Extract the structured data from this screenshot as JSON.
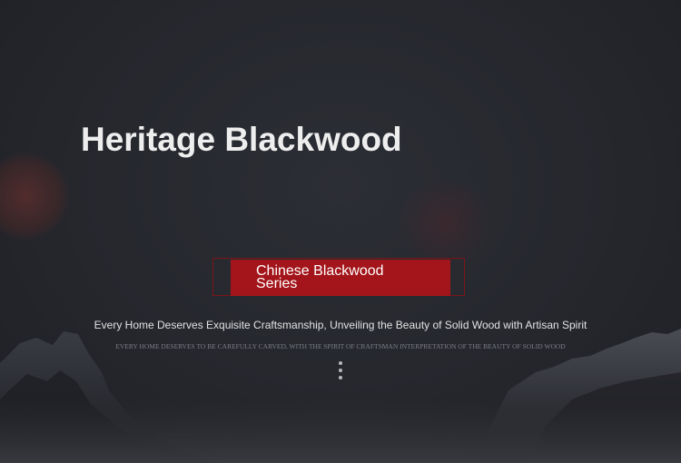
{
  "hero": {
    "title": "Heritage Blackwood",
    "series_button": {
      "line1": "Chinese Blackwood",
      "line2": "Series"
    },
    "tagline": "Every Home Deserves Exquisite Craftsmanship, Unveiling the Beauty of Solid Wood with Artisan Spirit",
    "tagline_sub": "EVERY HOME DESERVES TO BE CAREFULLY CARVED, WITH THE SPIRIT OF CRAFTSMAN INTERPRETATION OF THE BEAUTY OF SOLID WOOD"
  },
  "colors": {
    "background": "#25272d",
    "accent": "#a3151a",
    "title_text": "#eeeeee"
  },
  "icons": {
    "more": "vertical-ellipsis-icon"
  }
}
